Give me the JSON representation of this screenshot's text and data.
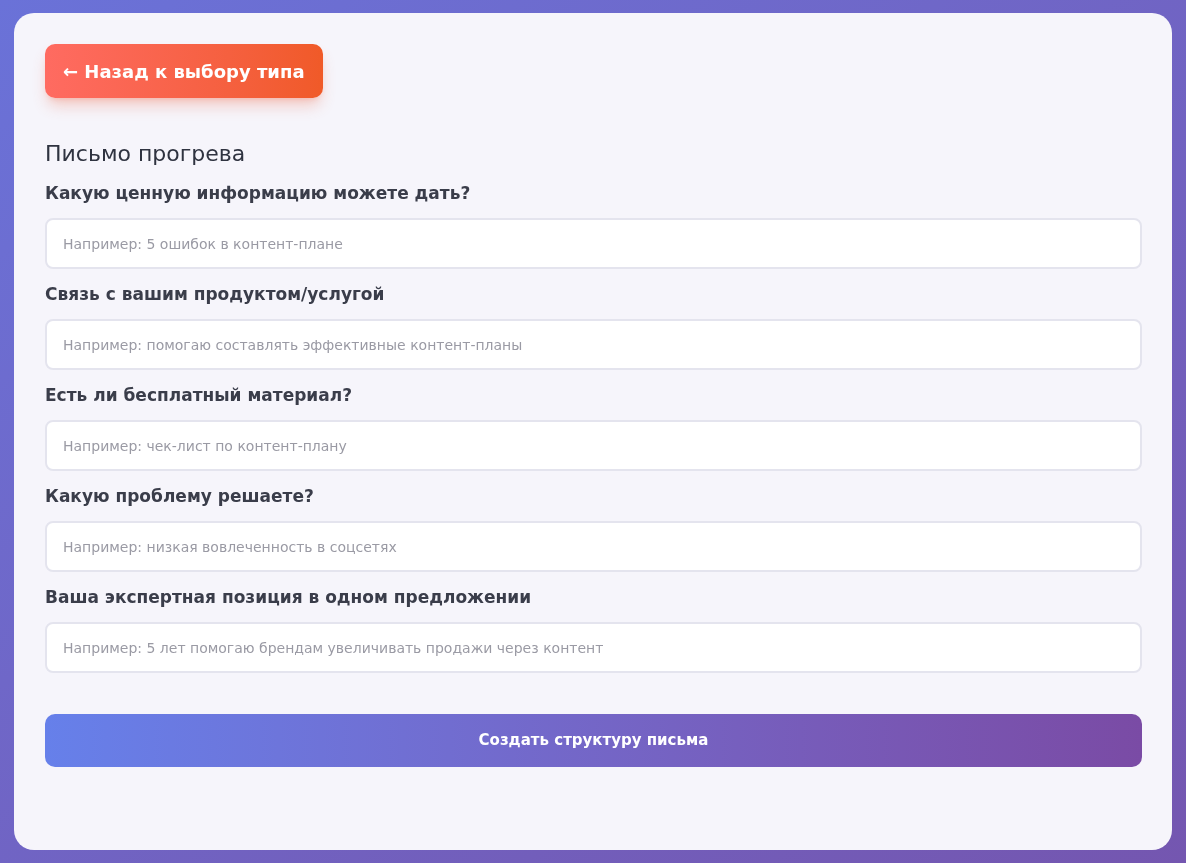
{
  "back_button": "← Назад к выбору типа",
  "title": "Письмо прогрева",
  "fields": [
    {
      "label": "Какую ценную информацию можете дать?",
      "placeholder": "Например: 5 ошибок в контент-плане"
    },
    {
      "label": "Связь с вашим продуктом/услугой",
      "placeholder": "Например: помогаю составлять эффективные контент-планы"
    },
    {
      "label": "Есть ли бесплатный материал?",
      "placeholder": "Например: чек-лист по контент-плану"
    },
    {
      "label": "Какую проблему решаете?",
      "placeholder": "Например: низкая вовлеченность в соцсетях"
    },
    {
      "label": "Ваша экспертная позиция в одном предложении",
      "placeholder": "Например: 5 лет помогаю брендам увеличивать продажи через контент"
    }
  ],
  "submit_button": "Создать структуру письма"
}
